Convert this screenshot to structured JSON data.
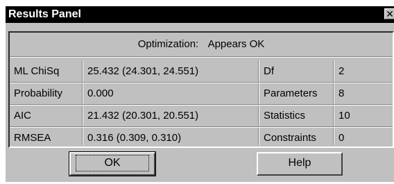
{
  "window": {
    "title": "Results Panel",
    "close_glyph": "✕"
  },
  "status": {
    "label": "Optimization:",
    "value": "Appears OK"
  },
  "rows": [
    {
      "label": "ML ChiSq",
      "value": "25.432 (24.301, 24.551)",
      "label2": "Df",
      "value2": "2"
    },
    {
      "label": "Probability",
      "value": "0.000",
      "label2": "Parameters",
      "value2": "8"
    },
    {
      "label": "AIC",
      "value": "21.432 (20.301, 20.551)",
      "label2": "Statistics",
      "value2": "10"
    },
    {
      "label": "RMSEA",
      "value": "0.316 (0.309, 0.310)",
      "label2": "Constraints",
      "value2": "0"
    }
  ],
  "buttons": {
    "ok": "OK",
    "help": "Help"
  }
}
